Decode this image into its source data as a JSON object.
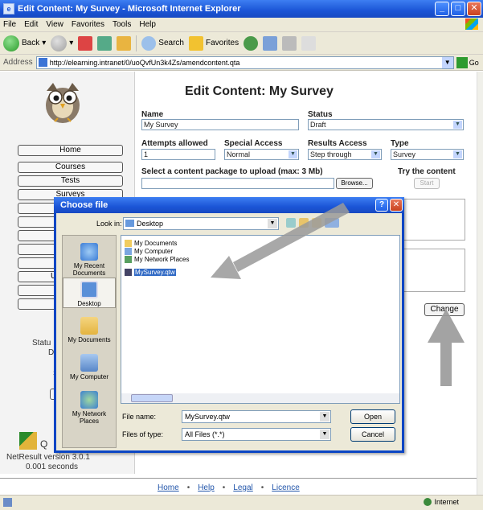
{
  "window": {
    "title": "Edit Content: My Survey - Microsoft Internet Explorer",
    "menu": [
      "File",
      "Edit",
      "View",
      "Favorites",
      "Tools",
      "Help"
    ],
    "toolbar": {
      "back": "Back",
      "search": "Search",
      "favorites": "Favorites"
    },
    "address_label": "Address",
    "address_url": "http://elearning.intranet/0/uoQvfUn3k4Zs/amendcontent.qta",
    "go_label": "Go",
    "status_zone": "Internet"
  },
  "sidebar": {
    "nav": [
      "Home",
      "Courses",
      "Tests",
      "Surveys"
    ],
    "status_partial": [
      "Statu",
      "De"
    ],
    "partial_letters": [
      "Us",
      "S"
    ],
    "product_partial": "Q",
    "version": "NetResult version 3.0.1",
    "timing": "0.001 seconds"
  },
  "main": {
    "title": "Edit Content: My Survey",
    "name_label": "Name",
    "name_value": "My Survey",
    "status_label": "Status",
    "status_value": "Draft",
    "attempts_label": "Attempts allowed",
    "attempts_value": "1",
    "special_label": "Special Access",
    "special_value": "Normal",
    "results_label": "Results Access",
    "results_value": "Step through",
    "type_label": "Type",
    "type_value": "Survey",
    "upload_label": "Select a content package to upload (max: 3 Mb)",
    "browse_label": "Browse...",
    "try_label": "Try the content",
    "start_label": "Start",
    "change_label": "Change"
  },
  "footer": {
    "links": [
      "Home",
      "Help",
      "Legal",
      "Licence"
    ]
  },
  "dialog": {
    "title": "Choose file",
    "look_in_label": "Look in:",
    "look_in_value": "Desktop",
    "places": [
      "My Recent Documents",
      "Desktop",
      "My Documents",
      "My Computer",
      "My Network Places"
    ],
    "files": [
      "My Documents",
      "My Computer",
      "My Network Places",
      "MySurvey.qtw"
    ],
    "file_name_label": "File name:",
    "file_name_value": "MySurvey.qtw",
    "file_type_label": "Files of type:",
    "file_type_value": "All Files (*.*)",
    "open_label": "Open",
    "cancel_label": "Cancel"
  },
  "colors": {
    "xp_blue": "#1b55d6",
    "xp_face": "#ece9d8",
    "arrow": "#9a9a9a",
    "selection": "#316ac5"
  }
}
